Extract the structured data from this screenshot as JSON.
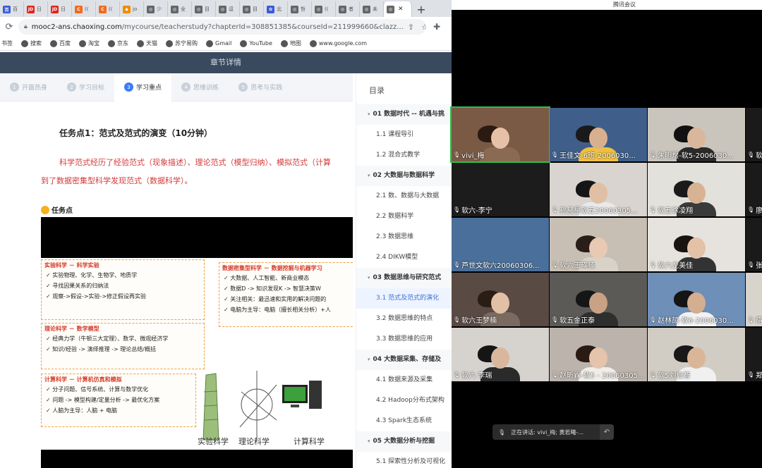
{
  "browser": {
    "tabs": [
      {
        "icon": "baidu-icon",
        "color": "#3b5bdb",
        "glyph": "百",
        "label": "百"
      },
      {
        "icon": "jd-icon",
        "color": "#e1251b",
        "glyph": "JD",
        "label": "日"
      },
      {
        "icon": "jd-icon",
        "color": "#e1251b",
        "glyph": "JD",
        "label": "日"
      },
      {
        "icon": "chaoxing-icon",
        "color": "#f26b1d",
        "glyph": "C",
        "label": "(("
      },
      {
        "icon": "chaoxing-icon",
        "color": "#f26b1d",
        "glyph": "C",
        "label": "(("
      },
      {
        "icon": "shield-icon",
        "color": "#f08c00",
        "glyph": "◆",
        "label": "jo"
      },
      {
        "icon": "globe-icon",
        "color": "#666666",
        "glyph": "◎",
        "label": "少"
      },
      {
        "icon": "globe-icon",
        "color": "#666666",
        "glyph": "◎",
        "label": "全"
      },
      {
        "icon": "globe-icon",
        "color": "#666666",
        "glyph": "◎",
        "label": "目"
      },
      {
        "icon": "globe-icon",
        "color": "#666666",
        "glyph": "◎",
        "label": "逗"
      },
      {
        "icon": "globe-icon",
        "color": "#666666",
        "glyph": "◎",
        "label": "目"
      },
      {
        "icon": "school-icon",
        "color": "#3b5bdb",
        "glyph": "✿",
        "label": "北"
      },
      {
        "icon": "globe-icon",
        "color": "#666666",
        "glyph": "◎",
        "label": "哲"
      },
      {
        "icon": "globe-icon",
        "color": "#666666",
        "glyph": "◎",
        "label": "(("
      },
      {
        "icon": "globe-icon",
        "color": "#666666",
        "glyph": "◎",
        "label": "者"
      },
      {
        "icon": "globe-icon",
        "color": "#666666",
        "glyph": "◎",
        "label": "未"
      }
    ],
    "active_tab": {
      "icon": "globe-icon",
      "close": "✕"
    },
    "new_tab": "+",
    "url_host": "mooc2-ans.chaoxing.com",
    "url_path": "/mycourse/teacherstudy?chapterId=308851385&courseId=211999660&clazz...",
    "bookmarks": [
      "书签",
      "搜索",
      "百度",
      "淘宝",
      "京东",
      "天猫",
      "苏宁易购",
      "Gmail",
      "YouTube",
      "地图",
      "www.google.com"
    ]
  },
  "page": {
    "header": "章节详情",
    "steps": [
      {
        "num": "1",
        "label": "开篇热身"
      },
      {
        "num": "2",
        "label": "学习目标"
      },
      {
        "num": "3",
        "label": "学习重点"
      },
      {
        "num": "4",
        "label": "思维训练"
      },
      {
        "num": "5",
        "label": "思考与实践"
      }
    ],
    "task_title": "任务点1：范式及范式的演变（10分钟）",
    "task_desc_line1": "科学范式经历了经验范式（现象描述）、理论范式（模型归纳）、模拟范式（计算",
    "task_desc_line2": "到了数据密集型科学发现范式（数据科学）。",
    "task_point_label": "任务点",
    "slide": {
      "exp_title": "实验科学 － 科学实验",
      "exp_items": [
        "实验物理、化学、生物学、地质学",
        "寻找因果关系的归纳法",
        "观察->假设->实验->修正假设再实验"
      ],
      "theory_title": "理论科学 － 数学模型",
      "theory_items": [
        "经典力学（牛顿三大定理）、数学、微观经济学",
        "知识/经验 -> 演绎推理 -> 理论总结/概括"
      ],
      "comp_title": "计算科学 － 计算机仿真和模拟",
      "comp_items": [
        "分子问题、信号系统、计算与数学优化",
        "问题 -> 模型构建/定量分析 -> 最优化方案",
        "人脑为主导：人脑 + 电脑"
      ],
      "data_title": "数据密集型科学 － 数据挖掘与机器学习",
      "data_items": [
        "大数据、人工智能、新商业模态",
        "数据D -> 知识发现K -> 智慧决策W",
        "关注相关：最迅速和实用的解决问题的",
        "电脑为主导：电脑（擅长相关分析）+人"
      ],
      "captions": [
        "实验科学",
        "理论科学",
        "计算科学"
      ]
    }
  },
  "toc": {
    "title": "目录",
    "entries": [
      {
        "type": "sec",
        "label": "01 数据时代 -- 机遇与挑"
      },
      {
        "type": "item",
        "label": "1.1 课程导引"
      },
      {
        "type": "item",
        "label": "1.2 混合式教学"
      },
      {
        "type": "sec",
        "label": "02 大数据与数据科学"
      },
      {
        "type": "item",
        "label": "2.1 数、数据与大数据"
      },
      {
        "type": "item",
        "label": "2.2 数据科学"
      },
      {
        "type": "item",
        "label": "2.3 数据思维"
      },
      {
        "type": "item",
        "label": "2.4 DIKW模型"
      },
      {
        "type": "sec",
        "label": "03 数据思维与研究范式"
      },
      {
        "type": "item",
        "label": "3.1 范式及范式的演化",
        "active": true
      },
      {
        "type": "item",
        "label": "3.2 数据思维的特点"
      },
      {
        "type": "item",
        "label": "3.3 数据思维的应用"
      },
      {
        "type": "sec",
        "label": "04 大数据采集、存储及"
      },
      {
        "type": "item",
        "label": "4.1 数据来源及采集"
      },
      {
        "type": "item",
        "label": "4.2 Hadoop分布式架构"
      },
      {
        "type": "item",
        "label": "4.3 Spark生态系统"
      },
      {
        "type": "sec",
        "label": "05 大数据分析与挖掘"
      },
      {
        "type": "item",
        "label": "5.1 探索性分析及可视化"
      }
    ]
  },
  "meeting": {
    "app_title": "腾讯会议",
    "participants": [
      {
        "name": "vivi_梅",
        "bg": "#7a5a45",
        "skin": "#e6c1a8",
        "hair": "#2a1a12",
        "body": "#8a6a52"
      },
      {
        "name": "王佳文-6班-2006030...",
        "bg": "#3f5f8a",
        "skin": "#d9b08f",
        "hair": "#1a1a1a",
        "body": "#f0c040"
      },
      {
        "name": "朱明煜-软5-2006030...",
        "bg": "#c9c4bc",
        "skin": "#d8b79c",
        "hair": "#111111",
        "body": "#2a2a2a"
      },
      {
        "name": "软",
        "bg": "#1a1a1a",
        "skin": "#1a1a1a",
        "hair": "#1a1a1a",
        "body": "#1a1a1a"
      },
      {
        "name": "软六-李宁",
        "bg": "#1c1c1c",
        "skin": "#1c1c1c",
        "hair": "#1c1c1c",
        "body": "#1c1c1c"
      },
      {
        "name": "孙赫星软五20060305...",
        "bg": "#d9d4cf",
        "skin": "#e0bfa4",
        "hair": "#151515",
        "body": "#e9e9e9"
      },
      {
        "name": "软五徐凌翔",
        "bg": "#e3e1dc",
        "skin": "#d7b394",
        "hair": "#1a1a1a",
        "body": "#3a3a3a"
      },
      {
        "name": "廖",
        "bg": "#1a1a1a",
        "skin": "#1a1a1a",
        "hair": "#1a1a1a",
        "body": "#1a1a1a"
      },
      {
        "name": "芦世文软六20060306...",
        "bg": "#4a6f9a",
        "skin": "#4a6f9a",
        "hair": "#4a6f9a",
        "body": "#4a6f9a"
      },
      {
        "name": "软六王瑛楠",
        "bg": "#c8bfb4",
        "skin": "#e8c9b4",
        "hair": "#2a1e18",
        "body": "#d9d2c8"
      },
      {
        "name": "软六龙美佳",
        "bg": "#e6e3de",
        "skin": "#e4c2a8",
        "hair": "#1a1410",
        "body": "#333333"
      },
      {
        "name": "张",
        "bg": "#1a1a1a",
        "skin": "#1a1a1a",
        "hair": "#1a1a1a",
        "body": "#1a1a1a"
      },
      {
        "name": "软六王梦楠",
        "bg": "#5a4a44",
        "skin": "#e2c0a6",
        "hair": "#2a1d16",
        "body": "#7a6a60"
      },
      {
        "name": "软五金正泰",
        "bg": "#5c5a56",
        "skin": "#c9a286",
        "hair": "#161616",
        "body": "#2e2e2e"
      },
      {
        "name": "赵林颉-软6-2006030...",
        "bg": "#6d8fb8",
        "skin": "#d4ae90",
        "hair": "#151515",
        "body": "#f2f2f2"
      },
      {
        "name": "隋",
        "bg": "#d8d4cc",
        "skin": "#d8d4cc",
        "hair": "#d8d4cc",
        "body": "#d8d4cc"
      },
      {
        "name": "软六 李瑞",
        "bg": "#d6d3cf",
        "skin": "#d8b79c",
        "hair": "#151515",
        "body": "#2a2a2a"
      },
      {
        "name": "赵昕霖-软5 - 20060305...",
        "bg": "#bcb4ac",
        "skin": "#e6c4ac",
        "hair": "#2a1c14",
        "body": "#f1ede8"
      },
      {
        "name": "软5刘启智",
        "bg": "#d1ccc4",
        "skin": "#d9b698",
        "hair": "#181818",
        "body": "#f0f0f0"
      },
      {
        "name": "郑",
        "bg": "#1a1a1a",
        "skin": "#1a1a1a",
        "hair": "#1a1a1a",
        "body": "#1a1a1a"
      }
    ],
    "speaking_label": "正在讲话: vivi_梅; 黄若曦-...",
    "share_icon": "↶"
  }
}
